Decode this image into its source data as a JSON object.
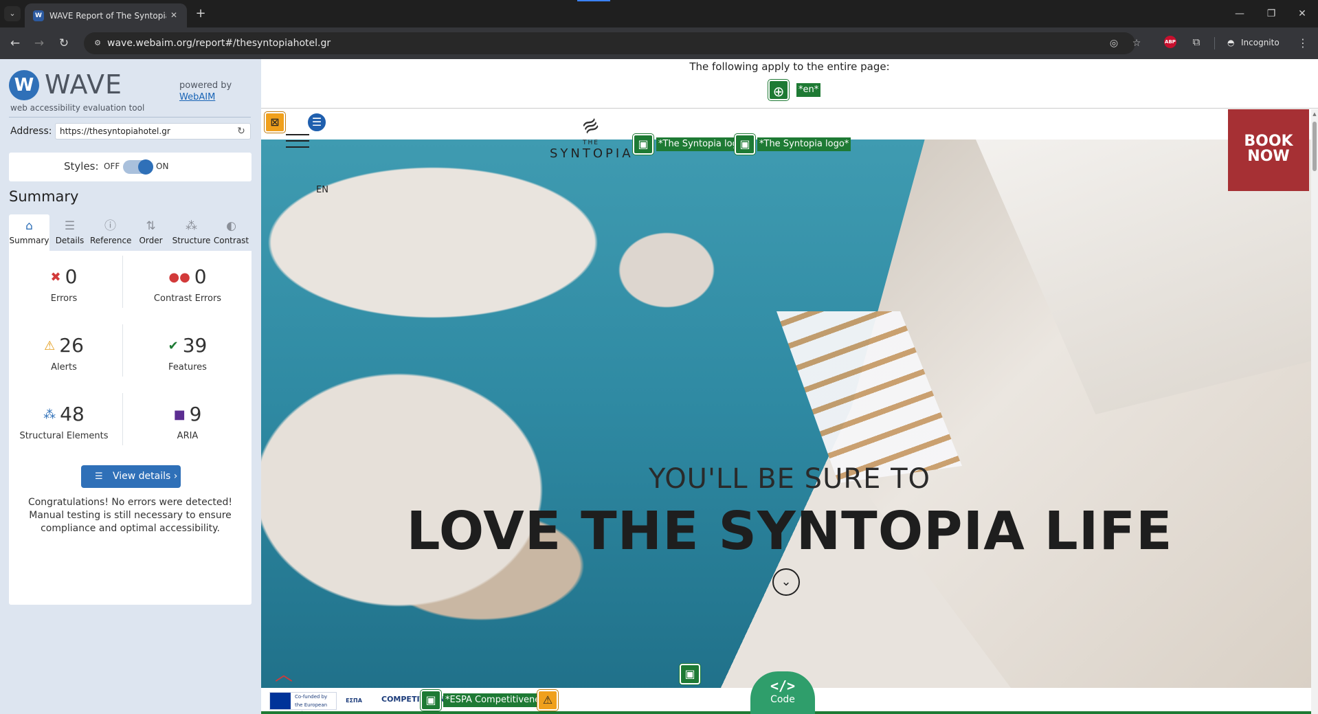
{
  "browser": {
    "tab_title": "WAVE Report of The Syntopia H",
    "url": "wave.webaim.org/report#/thesyntopiahotel.gr",
    "profile_label": "Incognito",
    "extension_abp": "ABP"
  },
  "wave": {
    "logo_letter": "W",
    "brand": "WAVE",
    "tagline": "web accessibility evaluation tool",
    "powered_by": "powered by",
    "powered_link": "WebAIM",
    "address_label": "Address:",
    "address_value": "https://thesyntopiahotel.gr",
    "styles_label": "Styles:",
    "styles_off": "OFF",
    "styles_on": "ON",
    "summary_heading": "Summary",
    "tabs": [
      {
        "label": "Summary",
        "icon": "home-icon"
      },
      {
        "label": "Details",
        "icon": "list-icon"
      },
      {
        "label": "Reference",
        "icon": "info-icon"
      },
      {
        "label": "Order",
        "icon": "order-icon"
      },
      {
        "label": "Structure",
        "icon": "structure-icon"
      },
      {
        "label": "Contrast",
        "icon": "contrast-icon"
      }
    ],
    "stats": {
      "errors": {
        "count": "0",
        "label": "Errors"
      },
      "contrast_errors": {
        "count": "0",
        "label": "Contrast Errors"
      },
      "alerts": {
        "count": "26",
        "label": "Alerts"
      },
      "features": {
        "count": "39",
        "label": "Features"
      },
      "structural": {
        "count": "48",
        "label": "Structural Elements"
      },
      "aria": {
        "count": "9",
        "label": "ARIA"
      }
    },
    "view_details": "View details ›",
    "congrats": "Congratulations! No errors were detected! Manual testing is still necessary to ensure compliance and optimal accessibility."
  },
  "report": {
    "applies_text": "The following apply to the entire page:",
    "lang_tag": "*en*",
    "logo_alt_1": "*The Syntopia logo*",
    "logo_alt_2": "*The Syntopia logo*",
    "espa_alt": "*ESPA Competitiveness*",
    "code_label": "Code",
    "code_glyph": "</>"
  },
  "site": {
    "brand_the": "THE",
    "brand_name": "SYNTOPIA",
    "lang": "EN",
    "book_now_1": "BOOK",
    "book_now_2": "NOW",
    "hero_top": "YOU'LL BE SURE TO",
    "hero_main": "LOVE THE SYNTOPIA LIFE",
    "footer_eu": "Co-funded by the European Union",
    "footer_espa": "ΕΣΠΑ",
    "footer_comp": "COMPETITIVENESS"
  },
  "colors": {
    "wave_blue": "#2f70b8",
    "feature_green": "#1e7a34",
    "alert_orange": "#f0a01c",
    "error_red": "#d23a3a",
    "book_now": "#a63034"
  }
}
